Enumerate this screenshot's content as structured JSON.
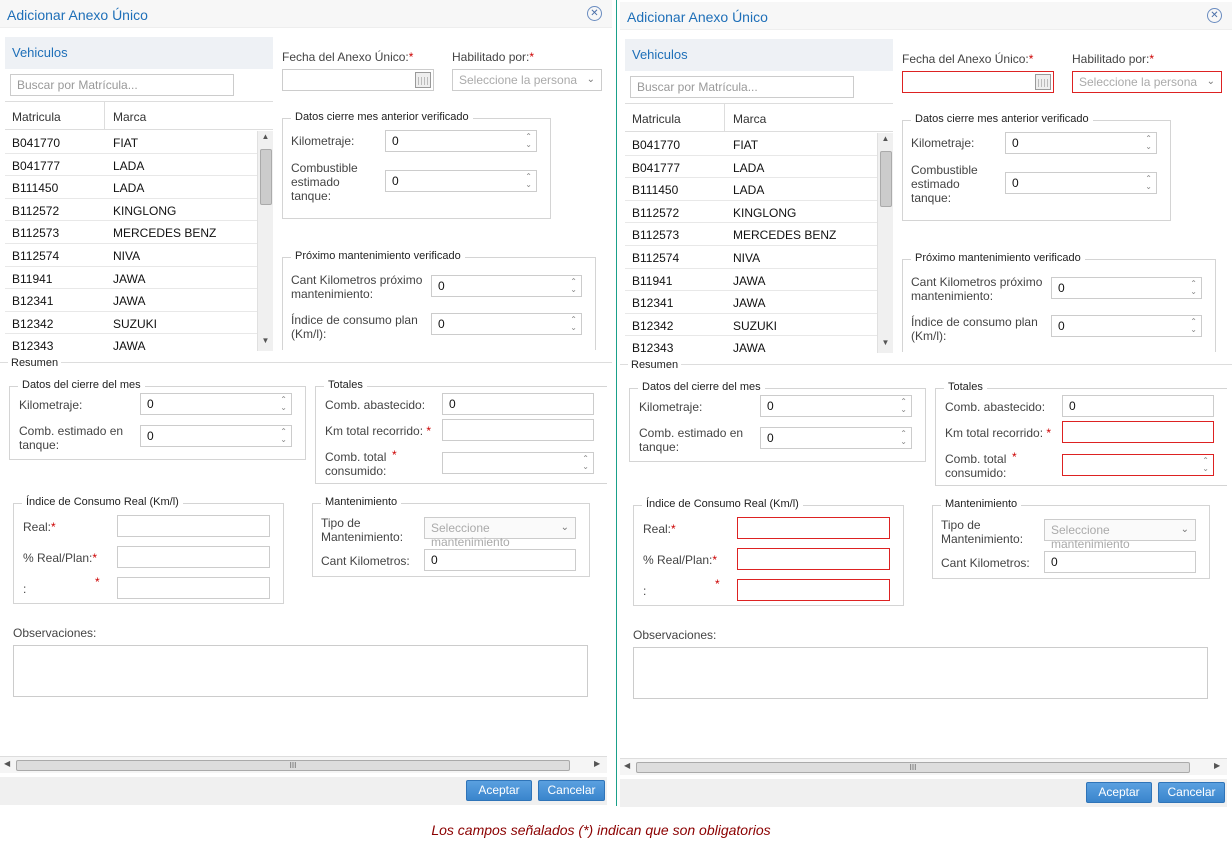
{
  "dialog": {
    "title": "Adicionar Anexo Único",
    "vehicles_header": "Vehiculos",
    "search_placeholder": "Buscar por Matrícula...",
    "columns": [
      "Matricula",
      "Marca"
    ],
    "vehicles": [
      {
        "plate": "B041770",
        "brand": "FIAT"
      },
      {
        "plate": "B041777",
        "brand": "LADA"
      },
      {
        "plate": "B111450",
        "brand": "LADA"
      },
      {
        "plate": "B112572",
        "brand": "KINGLONG"
      },
      {
        "plate": "B112573",
        "brand": "MERCEDES BENZ"
      },
      {
        "plate": "B112574",
        "brand": "NIVA"
      },
      {
        "plate": "B11941",
        "brand": "JAWA"
      },
      {
        "plate": "B12341",
        "brand": "JAWA"
      },
      {
        "plate": "B12342",
        "brand": "SUZUKI"
      },
      {
        "plate": "B12343",
        "brand": "JAWA"
      }
    ],
    "fecha_label": "Fecha del Anexo Único:",
    "habilitado_label": "Habilitado por:",
    "habilitado_placeholder": "Seleccione la persona",
    "cierre_anterior": {
      "title": "Datos cierre mes anterior verificado",
      "km_label": "Kilometraje:",
      "km_value": "0",
      "comb_label": "Combustible estimado tanque:",
      "comb_value": "0"
    },
    "proximo": {
      "title": "Próximo mantenimiento verificado",
      "cant_label": "Cant Kilometros próximo mantenimiento:",
      "cant_value": "0",
      "indice_label": "Índice de consumo plan (Km/l):",
      "indice_value": "0"
    },
    "resumen_label": "Resumen",
    "cierre_mes": {
      "title": "Datos del cierre del mes",
      "km_label": "Kilometraje:",
      "km_value": "0",
      "comb_label": "Comb. estimado en tanque:",
      "comb_value": "0"
    },
    "totales": {
      "title": "Totales",
      "abastecido_label": "Comb. abastecido:",
      "abastecido_value": "0",
      "km_total_label": "Km total recorrido:",
      "comb_total_label": "Comb. total consumido:"
    },
    "indice_real": {
      "title": "Índice de Consumo Real (Km/l)",
      "real_label": "Real:",
      "pct_label": "% Real/Plan:",
      "blank_label": ":"
    },
    "mantenimiento": {
      "title": "Mantenimiento",
      "tipo_label": "Tipo de Mantenimiento:",
      "tipo_placeholder": "Seleccione mantenimiento",
      "cant_label": "Cant Kilometros:",
      "cant_value": "0"
    },
    "observaciones_label": "Observaciones:",
    "accept_label": "Aceptar",
    "cancel_label": "Cancelar",
    "required_mark": "*",
    "scroll_grip": "III"
  },
  "caption": "Los campos señalados (*) indican que son obligatorios",
  "colors": {
    "accent": "#1e6fb8",
    "error": "#dd2222",
    "button": "#3a85cc",
    "caption": "#8b0000"
  }
}
